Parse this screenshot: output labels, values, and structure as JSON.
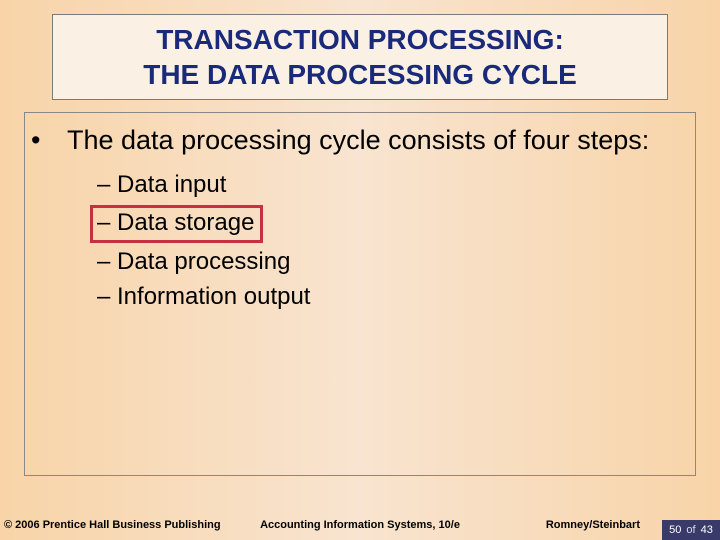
{
  "title": {
    "line1": "TRANSACTION PROCESSING:",
    "line2": "THE DATA PROCESSING CYCLE"
  },
  "body": {
    "lead": "The data processing cycle consists of four steps:",
    "items": [
      {
        "text": "Data input",
        "highlight": false
      },
      {
        "text": "Data storage",
        "highlight": true
      },
      {
        "text": "Data processing",
        "highlight": false
      },
      {
        "text": "Information output",
        "highlight": false
      }
    ]
  },
  "footer": {
    "copyright": "© 2006 Prentice Hall Business Publishing",
    "center": "Accounting Information Systems, 10/e",
    "authors": "Romney/Steinbart",
    "page_current": "50",
    "page_of": "of",
    "page_total": "43"
  }
}
